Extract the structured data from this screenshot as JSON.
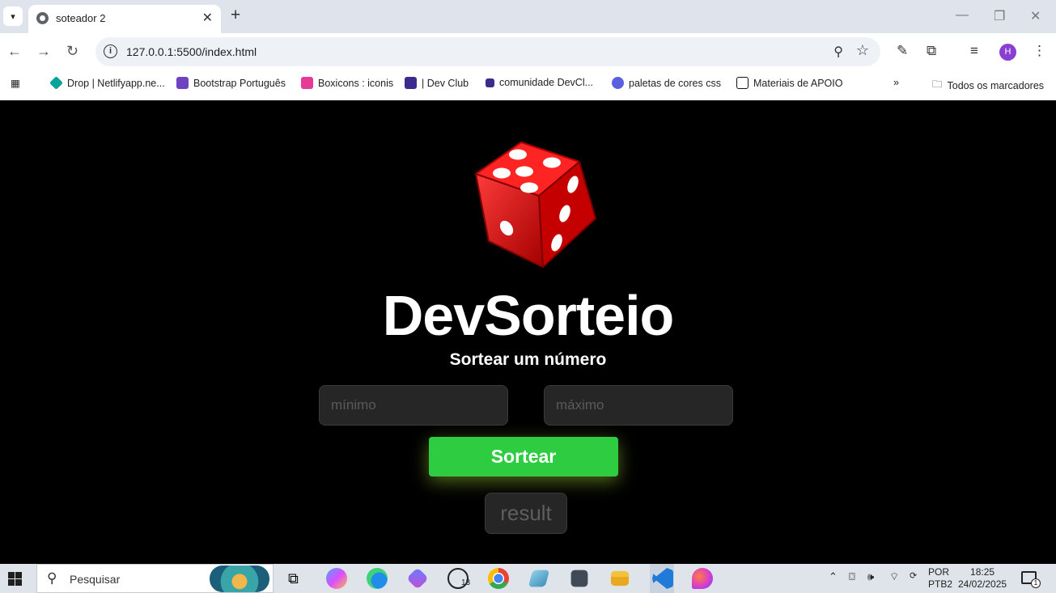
{
  "browser": {
    "tab_title": "soteador 2",
    "url": "127.0.0.1:5500/index.html",
    "profile_initial": "H"
  },
  "bookmarks": [
    {
      "label": "Drop | Netlifyapp.ne...",
      "icon": "netlify-icon",
      "color": "#0aa39a"
    },
    {
      "label": "Bootstrap  Português",
      "icon": "bootstrap-icon",
      "color": "#6f42c1"
    },
    {
      "label": "Boxicons : iconis",
      "icon": "boxicons-icon",
      "color": "#e63998"
    },
    {
      "label": "| Dev Club",
      "icon": "devclub-icon",
      "color": "#3a2b8c"
    },
    {
      "label": "comunidade  DevCl...",
      "icon": "devclub-square-icon",
      "color": "#3a2b8c"
    },
    {
      "label": "paletas de cores css",
      "icon": "palette-icon",
      "color": "#5a5fe0"
    },
    {
      "label": "Materiais de APOIO",
      "icon": "notion-icon",
      "color": "#111111"
    }
  ],
  "bookmarks_all": "Todos os marcadores",
  "app": {
    "brand": "DevSorteio",
    "subtitle": "Sortear um número",
    "min_placeholder": "mínimo",
    "max_placeholder": "máximo",
    "button_label": "Sortear",
    "result": "result",
    "accent": "#2ecc40"
  },
  "taskbar": {
    "search_placeholder": "Pesquisar",
    "whatsapp_badge": "13",
    "lang_top": "POR",
    "lang_bottom": "PTB2",
    "time": "18:25",
    "date": "24/02/2025",
    "notif_count": "1"
  }
}
